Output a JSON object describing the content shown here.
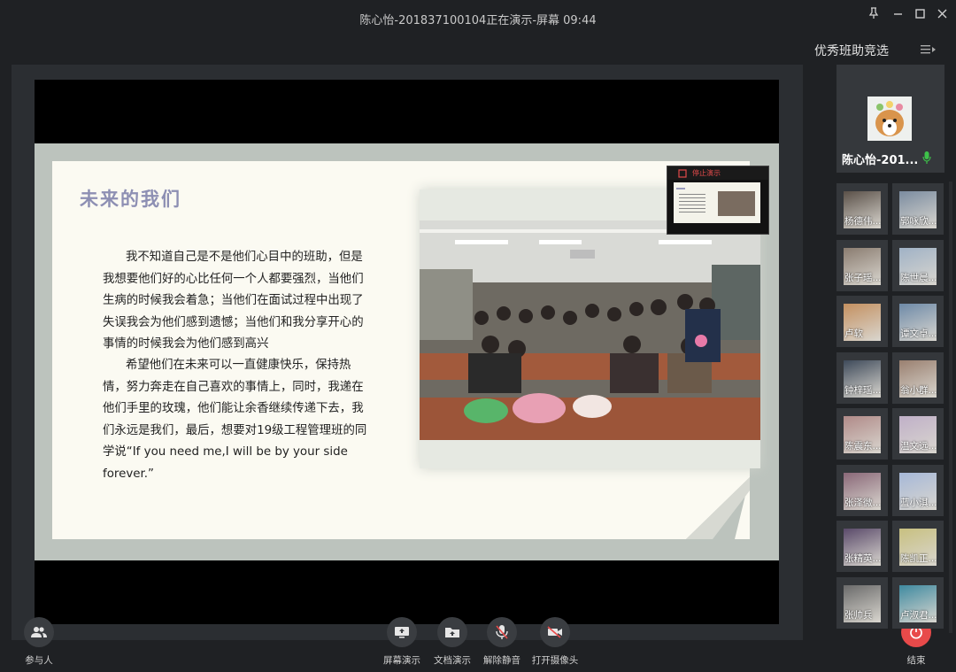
{
  "window": {
    "title": "陈心怡-201837100104正在演示-屏幕 09:44",
    "controls": [
      "pin-icon",
      "minimize-icon",
      "maximize-icon",
      "close-icon"
    ]
  },
  "slide": {
    "title": "未来的我们",
    "paragraph1": "我不知道自己是不是他们心目中的班助，但是我想要他们好的心比任何一个人都要强烈，当他们生病的时候我会着急；当他们在面试过程中出现了失误我会为他们感到遗憾；当他们和我分享开心的事情的时候我会为他们感到高兴",
    "paragraph2": "希望他们在未来可以一直健康快乐，保持热情，努力奔走在自己喜欢的事情上，同时，我递在他们手里的玫瑰，他们能让余香继续传递下去，我们永远是我们，最后，想要对19级工程管理班的同学说“If you need me,I will be by your side forever.”",
    "mini_stop_label": "停止演示"
  },
  "controls": {
    "participants": "参与人",
    "screen_share": "屏幕演示",
    "doc_share": "文档演示",
    "unmute": "解除静音",
    "camera": "打开摄像头",
    "end": "结束"
  },
  "panel": {
    "title": "优秀班助竞选",
    "host_name": "陈心怡-201...",
    "participants": [
      {
        "name": "杨德伟..."
      },
      {
        "name": "郭咏欣..."
      },
      {
        "name": "张子瑶..."
      },
      {
        "name": "陈世晨..."
      },
      {
        "name": "卢软"
      },
      {
        "name": "谭文卓..."
      },
      {
        "name": "钟梓瑶..."
      },
      {
        "name": "翁小群..."
      },
      {
        "name": "陈震东..."
      },
      {
        "name": "温文远..."
      },
      {
        "name": "张泽微..."
      },
      {
        "name": "蓝小淇..."
      },
      {
        "name": "张精英..."
      },
      {
        "name": "陈凯正..."
      },
      {
        "name": "张帅兵"
      },
      {
        "name": "卢淑君..."
      }
    ]
  },
  "colors": {
    "accent_red": "#e84a4a",
    "mic_green": "#3ec24a",
    "slide_title": "#8d8fb3"
  }
}
